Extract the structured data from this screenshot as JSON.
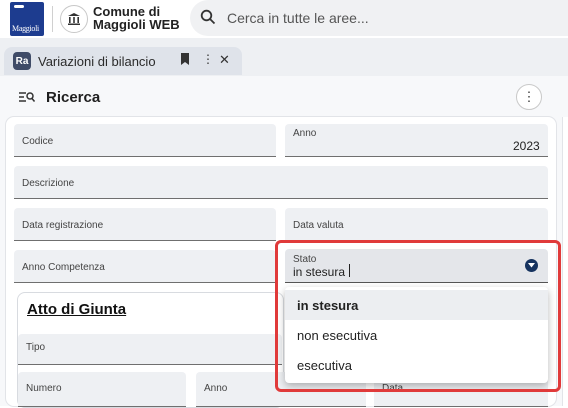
{
  "header": {
    "logo_text": "Maggioli",
    "app_title_line1": "Comune di",
    "app_title_line2": "Maggioli WEB",
    "search_placeholder": "Cerca in tutte le aree..."
  },
  "tab": {
    "badge": "Ra",
    "label": "Variazioni di bilancio"
  },
  "page": {
    "title": "Ricerca"
  },
  "form": {
    "codice_label": "Codice",
    "anno_label": "Anno",
    "anno_value": "2023",
    "descrizione_label": "Descrizione",
    "data_registrazione_label": "Data registrazione",
    "data_valuta_label": "Data valuta",
    "anno_competenza_label": "Anno Competenza",
    "stato_label": "Stato",
    "stato_value": "in stesura",
    "atto_title": "Atto di Giunta",
    "tipo_label": "Tipo",
    "numero_label": "Numero",
    "atto_anno_label": "Anno",
    "data_label": "Data"
  },
  "stato_options": [
    "in stesura",
    "non esecutiva",
    "esecutiva"
  ],
  "colors": {
    "accent": "#16335f",
    "highlight": "#e03a3a",
    "brand": "#1d3c8f"
  }
}
